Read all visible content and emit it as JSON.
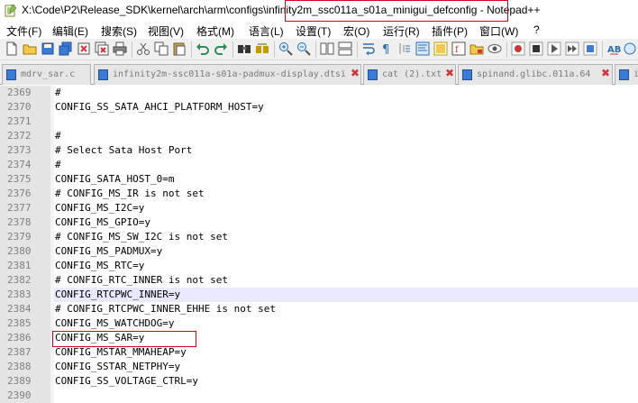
{
  "window": {
    "title_prefix": "X:\\Code\\P2\\Release_SDK\\kernel\\arch\\arm\\configs\\",
    "title_file": "infinity2m_ssc011a_s01a_minigui_defconfig",
    "title_suffix": " - Notepad++"
  },
  "menu": [
    "文件(F)",
    "编辑(E)",
    "搜索(S)",
    "视图(V)",
    "格式(M)",
    "语言(L)",
    "设置(T)",
    "宏(O)",
    "运行(R)",
    "插件(P)",
    "窗口(W)",
    "?"
  ],
  "tabs": [
    {
      "label": "mdrv_sar.c",
      "active": false
    },
    {
      "label": "infinity2m-ssc011a-s01a-padmux-display.dtsi",
      "active": false
    },
    {
      "label": "cat (2).txt",
      "active": false
    },
    {
      "label": "spinand.glibc.011a.64",
      "active": false
    },
    {
      "label": "in",
      "active": false
    }
  ],
  "editor": {
    "current_line": "2383",
    "lines": [
      {
        "num": "2369",
        "text": "#"
      },
      {
        "num": "2370",
        "text": "CONFIG_SS_SATA_AHCI_PLATFORM_HOST=y"
      },
      {
        "num": "2371",
        "text": ""
      },
      {
        "num": "2372",
        "text": "#"
      },
      {
        "num": "2373",
        "text": "# Select Sata Host Port"
      },
      {
        "num": "2374",
        "text": "#"
      },
      {
        "num": "2375",
        "text": "CONFIG_SATA_HOST_0=m"
      },
      {
        "num": "2376",
        "text": "# CONFIG_MS_IR is not set"
      },
      {
        "num": "2377",
        "text": "CONFIG_MS_I2C=y"
      },
      {
        "num": "2378",
        "text": "CONFIG_MS_GPIO=y"
      },
      {
        "num": "2379",
        "text": "# CONFIG_MS_SW_I2C is not set"
      },
      {
        "num": "2380",
        "text": "CONFIG_MS_PADMUX=y"
      },
      {
        "num": "2381",
        "text": "CONFIG_MS_RTC=y"
      },
      {
        "num": "2382",
        "text": "# CONFIG_RTC_INNER is not set"
      },
      {
        "num": "2383",
        "text": "CONFIG_RTCPWC_INNER=y"
      },
      {
        "num": "2384",
        "text": "# CONFIG_RTCPWC_INNER_EHHE is not set"
      },
      {
        "num": "2385",
        "text": "CONFIG_MS_WATCHDOG=y"
      },
      {
        "num": "2386",
        "text": "CONFIG_MS_SAR=y"
      },
      {
        "num": "2387",
        "text": "CONFIG_MSTAR_MMAHEAP=y"
      },
      {
        "num": "2388",
        "text": "CONFIG_SSTAR_NETPHY=y"
      },
      {
        "num": "2389",
        "text": "CONFIG_SS_VOLTAGE_CTRL=y"
      },
      {
        "num": "2390",
        "text": ""
      }
    ]
  },
  "colors": {
    "annotation_box": "#d0021b",
    "current_line_bg": "#e8e8ff",
    "active_tab_accent": "#f9a61a"
  }
}
